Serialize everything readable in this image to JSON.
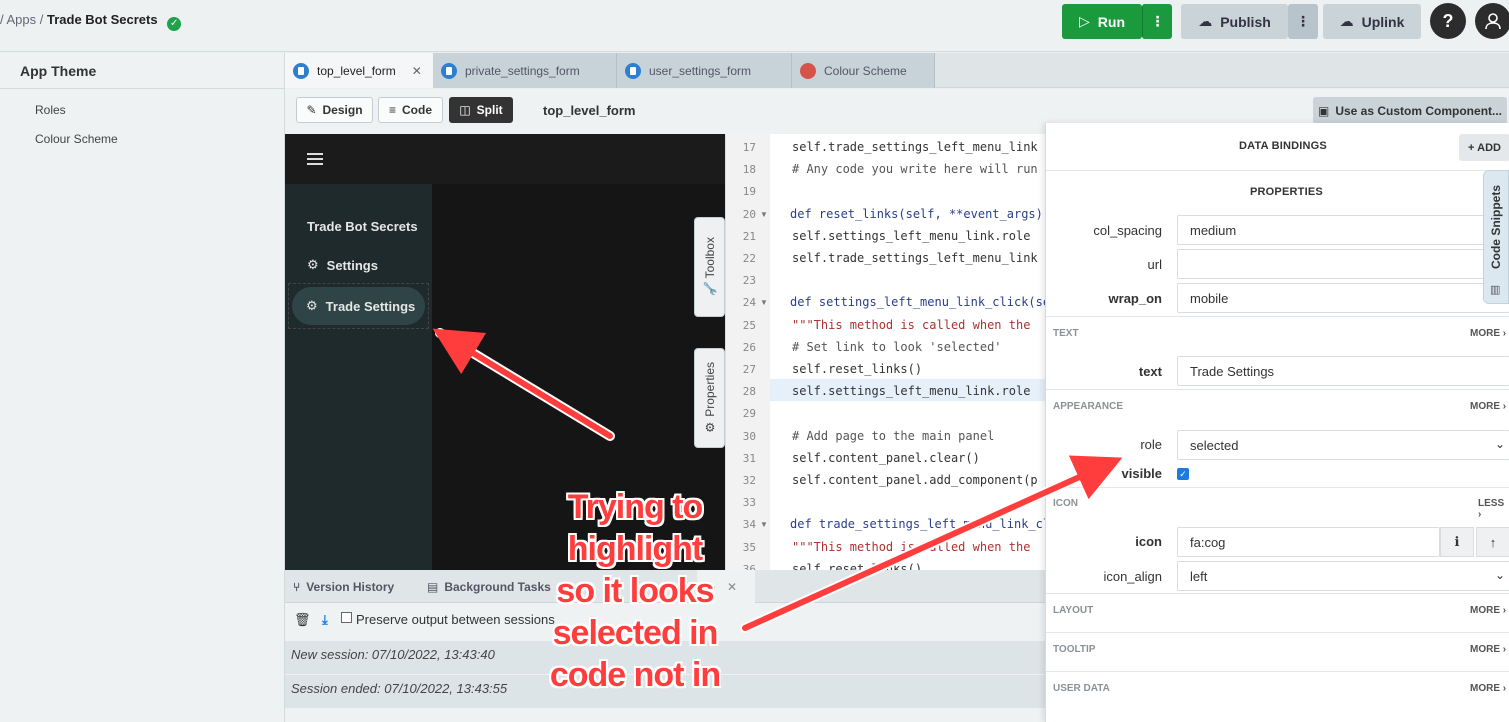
{
  "breadcrumb": {
    "prefix": "/ Apps /",
    "app_name": "Trade Bot Secrets"
  },
  "header": {
    "run_label": "Run",
    "publish_label": "Publish",
    "uplink_label": "Uplink",
    "help_label": "?"
  },
  "sidebar": {
    "title": "App Theme",
    "items": [
      {
        "label": "Roles"
      },
      {
        "label": "Colour Scheme"
      }
    ]
  },
  "tabs": [
    {
      "label": "top_level_form",
      "active": true
    },
    {
      "label": "private_settings_form",
      "active": false
    },
    {
      "label": "user_settings_form",
      "active": false
    },
    {
      "label": "Colour Scheme",
      "active": false
    }
  ],
  "toolbar": {
    "design_label": "Design",
    "code_label": "Code",
    "split_label": "Split",
    "form_title": "top_level_form",
    "custom_component_label": "Use as Custom Component..."
  },
  "canvas": {
    "nav_items": [
      {
        "label": "Trade Bot Secrets"
      },
      {
        "label": "Settings"
      },
      {
        "label": "Trade Settings"
      }
    ]
  },
  "side_handles": {
    "toolbox_label": "Toolbox",
    "properties_label": "Properties"
  },
  "code": {
    "lines": [
      {
        "n": "17",
        "text": "self.trade_settings_left_menu_link"
      },
      {
        "n": "18",
        "text": "# Any code you write here will run"
      },
      {
        "n": "19",
        "text": ""
      },
      {
        "n": "20",
        "text": "def reset_links(self, **event_args):"
      },
      {
        "n": "21",
        "text": "self.settings_left_menu_link.role"
      },
      {
        "n": "22",
        "text": "self.trade_settings_left_menu_link"
      },
      {
        "n": "23",
        "text": ""
      },
      {
        "n": "24",
        "text": "def settings_left_menu_link_click(se"
      },
      {
        "n": "25",
        "text": "\"\"\"This method is called when the"
      },
      {
        "n": "26",
        "text": "# Set link to look 'selected'"
      },
      {
        "n": "27",
        "text": "self.reset_links()"
      },
      {
        "n": "28",
        "text": "self.settings_left_menu_link.role"
      },
      {
        "n": "29",
        "text": ""
      },
      {
        "n": "30",
        "text": "# Add page to the main panel"
      },
      {
        "n": "31",
        "text": "self.content_panel.clear()"
      },
      {
        "n": "32",
        "text": "self.content_panel.add_component(p"
      },
      {
        "n": "33",
        "text": ""
      },
      {
        "n": "34",
        "text": "def trade_settings_left_menu_link_cl"
      },
      {
        "n": "35",
        "text": "\"\"\"This method is called when the"
      },
      {
        "n": "36",
        "text": "self.reset_links()"
      }
    ]
  },
  "bottom": {
    "tabs": [
      {
        "label": "Version History"
      },
      {
        "label": "Background Tasks"
      },
      {
        "label": "le"
      }
    ],
    "preserve_label": "Preserve output between sessions",
    "log": [
      "New session: 07/10/2022, 13:43:40",
      "Session ended: 07/10/2022, 13:43:55"
    ]
  },
  "props": {
    "data_bindings_title": "DATA BINDINGS",
    "add_label": "+ ADD",
    "properties_title": "PROPERTIES",
    "col_spacing": {
      "label": "col_spacing",
      "value": "medium"
    },
    "url": {
      "label": "url",
      "value": ""
    },
    "wrap_on": {
      "label": "wrap_on",
      "value": "mobile"
    },
    "text_section": "TEXT",
    "text": {
      "label": "text",
      "value": "Trade Settings"
    },
    "appearance_section": "APPEARANCE",
    "role": {
      "label": "role",
      "value": "selected"
    },
    "visible": {
      "label": "visible",
      "checked": true
    },
    "icon_section": "ICON",
    "icon": {
      "label": "icon",
      "value": "fa:cog"
    },
    "icon_align": {
      "label": "icon_align",
      "value": "left"
    },
    "layout_section": "LAYOUT",
    "tooltip_section": "TOOLTIP",
    "user_data_section": "USER DATA",
    "more_label": "MORE",
    "less_label": "LESS",
    "snippets_label": "Code Snippets"
  },
  "annotation": {
    "lines": [
      "Trying to",
      "highlight",
      "so it looks",
      "selected in",
      "code not in"
    ],
    "color": "#ff3d3d"
  }
}
